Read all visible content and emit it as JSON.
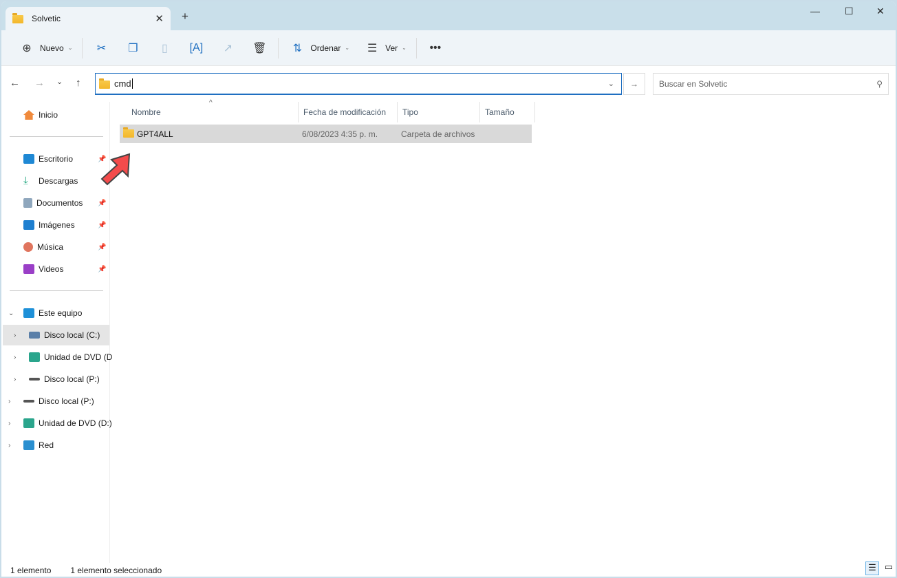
{
  "window": {
    "tab_title": "Solvetic"
  },
  "toolbar": {
    "new": "Nuevo",
    "sort": "Ordenar",
    "view": "Ver"
  },
  "address": {
    "path": "cmd",
    "search_placeholder": "Buscar en Solvetic"
  },
  "sidebar": {
    "home": "Inicio",
    "pinned": [
      "Escritorio",
      "Descargas",
      "Documentos",
      "Imágenes",
      "Música",
      "Videos"
    ],
    "this_pc": "Este equipo",
    "drives": [
      "Disco local (C:)",
      "Unidad de DVD (D",
      "Disco local (P:)"
    ],
    "root": [
      "Disco local (P:)",
      "Unidad de DVD (D:)",
      "Red"
    ]
  },
  "columns": [
    "Nombre",
    "Fecha de modificación",
    "Tipo",
    "Tamaño"
  ],
  "rows": [
    {
      "name": "GPT4ALL",
      "date": "6/08/2023 4:35 p. m.",
      "type": "Carpeta de archivos",
      "size": ""
    }
  ],
  "status": {
    "count": "1 elemento",
    "selected": "1 elemento seleccionado"
  },
  "colors": {
    "accent": "#1f6fc1",
    "selection": "#d9d9d9",
    "annotation_arrow": "#f44b4b"
  }
}
